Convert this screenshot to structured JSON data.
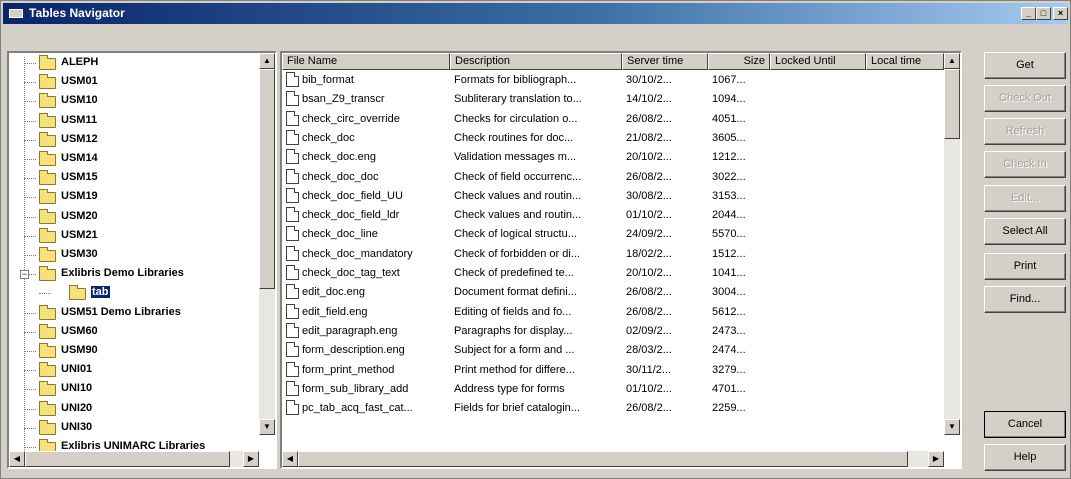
{
  "window": {
    "title": "Tables Navigator",
    "min": "_",
    "max": "□",
    "close": "×"
  },
  "tree": {
    "items": [
      {
        "label": "ALEPH",
        "depth": 0
      },
      {
        "label": "USM01",
        "depth": 0
      },
      {
        "label": "USM10",
        "depth": 0
      },
      {
        "label": "USM11",
        "depth": 0
      },
      {
        "label": "USM12",
        "depth": 0
      },
      {
        "label": "USM14",
        "depth": 0
      },
      {
        "label": "USM15",
        "depth": 0
      },
      {
        "label": "USM19",
        "depth": 0
      },
      {
        "label": "USM20",
        "depth": 0
      },
      {
        "label": "USM21",
        "depth": 0
      },
      {
        "label": "USM30",
        "depth": 0
      },
      {
        "label": "Exlibris Demo Libraries",
        "depth": 0,
        "expander": "−"
      },
      {
        "label": "tab",
        "depth": 1,
        "selected": true
      },
      {
        "label": "USM51 Demo Libraries",
        "depth": 0
      },
      {
        "label": "USM60",
        "depth": 0
      },
      {
        "label": "USM90",
        "depth": 0
      },
      {
        "label": "UNI01",
        "depth": 0
      },
      {
        "label": "UNI10",
        "depth": 0
      },
      {
        "label": "UNI20",
        "depth": 0
      },
      {
        "label": "UNI30",
        "depth": 0
      },
      {
        "label": "Exlibris UNIMARC Libraries",
        "depth": 0
      }
    ]
  },
  "list": {
    "columns": [
      "File Name",
      "Description",
      "Server time",
      "Size",
      "Locked Until",
      "Local time"
    ],
    "rows": [
      [
        "bib_format",
        "Formats for bibliograph...",
        "30/10/2...",
        "1067..."
      ],
      [
        "bsan_Z9_transcr",
        "Subliterary translation to...",
        "14/10/2...",
        "1094..."
      ],
      [
        "check_circ_override",
        "Checks for circulation o...",
        "26/08/2...",
        "4051..."
      ],
      [
        "check_doc",
        "Check routines for doc...",
        "21/08/2...",
        "3605..."
      ],
      [
        "check_doc.eng",
        "Validation messages m...",
        "20/10/2...",
        "1212..."
      ],
      [
        "check_doc_doc",
        "Check of field occurrenc...",
        "26/08/2...",
        "3022..."
      ],
      [
        "check_doc_field_UU",
        "Check values and routin...",
        "30/08/2...",
        "3153..."
      ],
      [
        "check_doc_field_ldr",
        "Check values and routin...",
        "01/10/2...",
        "2044..."
      ],
      [
        "check_doc_line",
        "Check of logical structu...",
        "24/09/2...",
        "5570..."
      ],
      [
        "check_doc_mandatory",
        "Check of forbidden or di...",
        "18/02/2...",
        "1512..."
      ],
      [
        "check_doc_tag_text",
        "Check of predefined te...",
        "20/10/2...",
        "1041..."
      ],
      [
        "edit_doc.eng",
        "Document format defini...",
        "26/08/2...",
        "3004..."
      ],
      [
        "edit_field.eng",
        "Editing of fields and fo...",
        "26/08/2...",
        "5612..."
      ],
      [
        "edit_paragraph.eng",
        "Paragraphs for display...",
        "02/09/2...",
        "2473..."
      ],
      [
        "form_description.eng",
        "Subject for a form and ...",
        "28/03/2...",
        "2474..."
      ],
      [
        "form_print_method",
        "Print method for differe...",
        "30/11/2...",
        "3279..."
      ],
      [
        "form_sub_library_add",
        "Address type for forms",
        "01/10/2...",
        "4701..."
      ],
      [
        "pc_tab_acq_fast_cat...",
        "Fields for brief catalogin...",
        "26/08/2...",
        "2259..."
      ]
    ]
  },
  "buttons": {
    "get": "Get",
    "check_out": "Check Out",
    "refresh": "Refresh",
    "check_in": "Check In",
    "edit": "Edit...",
    "select_all": "Select All",
    "print": "Print",
    "find": "Find...",
    "cancel": "Cancel",
    "help": "Help"
  }
}
